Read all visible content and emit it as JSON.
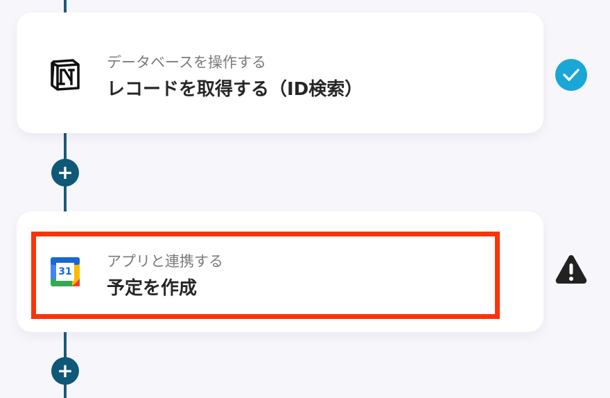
{
  "steps": [
    {
      "subtitle": "データベースを操作する",
      "title": "レコードを取得する（ID検索）",
      "app_icon": "notion-icon",
      "status": "complete",
      "status_icon": "check-icon",
      "status_color": "#1aa7d8"
    },
    {
      "subtitle": "アプリと連携する",
      "title": "予定を作成",
      "app_icon": "google-calendar-icon",
      "calendar_number": "31",
      "status": "warning",
      "status_icon": "warning-icon",
      "status_color": "#222222"
    }
  ],
  "add_step_icon": "plus-icon",
  "colors": {
    "connector": "#1f5a78",
    "add_button": "#0f5877",
    "highlight": "#fa3407",
    "background": "#f7f6fb"
  }
}
